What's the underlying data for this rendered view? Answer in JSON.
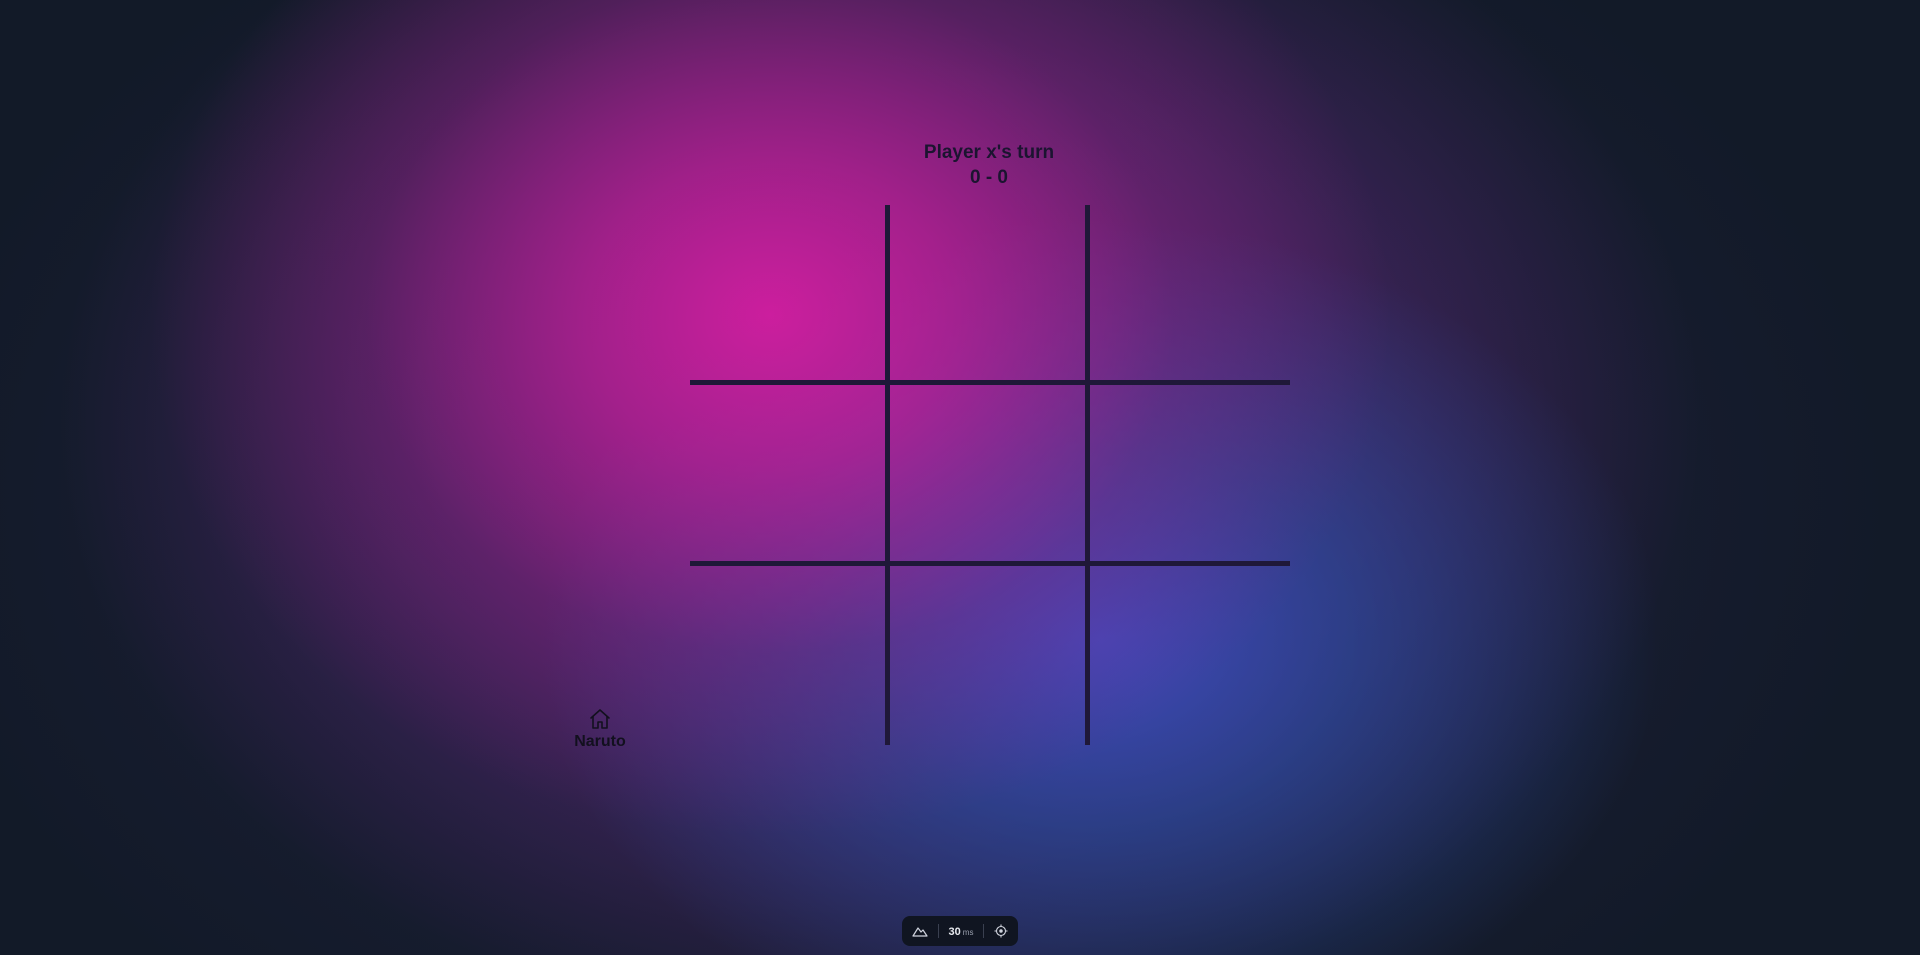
{
  "game": {
    "turn_text": "Player x's turn",
    "score_text": "0 - 0",
    "board": [
      "",
      "",
      "",
      "",
      "",
      "",
      "",
      "",
      ""
    ]
  },
  "home": {
    "icon": "home-icon",
    "label": "Naruto"
  },
  "perf_bar": {
    "left_icon": "mountain-icon",
    "value": "30",
    "unit": "ms",
    "right_icon": "crosshair-icon"
  },
  "colors": {
    "grid_line": "#1f1838",
    "text": "#1b1430",
    "pink_glow": "#d21ea0",
    "blue_glow": "#3c50c8",
    "background": "#121a28"
  }
}
